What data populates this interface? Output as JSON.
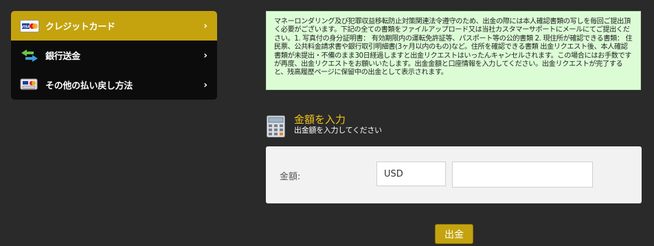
{
  "sidebar": {
    "items": [
      {
        "label": "クレジットカード",
        "icon": "visa-mastercard-icon",
        "active": true,
        "chevron": "›"
      },
      {
        "label": "銀行送金",
        "icon": "bank-transfer-arrows-icon",
        "active": false,
        "chevron": "›"
      },
      {
        "label": "その他の払い戻し方法",
        "icon": "credit-cards-icon",
        "active": false,
        "chevron": "›"
      }
    ]
  },
  "notice": {
    "text": "マネーロンダリング及び犯罪収益移転防止対策関連法令遵守のため、出金の際には本人確認書類の写しを毎回ご提出頂く必要がございます。下記の全ての書類をファイルアップロード又は当社カスタマーサポートにメールにてご提出ください。1. 写真付の身分証明書： 有効期限内の運転免許証等、パスポート等の公的書類 2. 現住所が確認できる書類： 住民票、公共料金請求書や銀行取引明細書(3ヶ月以内のもの)など。住所を確認できる書類 出金リクエスト後、本人確認書類が未提出・不備のまま30日経過しますと出金リクエストはいったんキャンセルされます。この場合にはお手数ですが再度、出金リクエストをお願いいたします。出金金額と口座情報を入力してください。出金リクエストが完了すると、残高履歴ページに保留中の出金として表示されます。"
  },
  "section": {
    "title": "金額を入力",
    "subtitle": "出金額を入力してください",
    "icon": "calculator-icon"
  },
  "amount_form": {
    "label": "金額:",
    "currency": "USD",
    "amount_value": "",
    "amount_placeholder": ""
  },
  "actions": {
    "withdraw_label": "出金"
  },
  "colors": {
    "accent": "#c4a30f",
    "background": "#2a2a2a",
    "notice_bg": "#dcfcd6",
    "title_color": "#f0c418"
  }
}
